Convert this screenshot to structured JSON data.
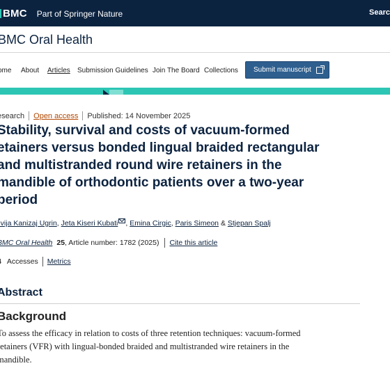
{
  "header": {
    "brand": "BMC",
    "part_of": "Part of Springer Nature",
    "search": "Searc"
  },
  "journal": {
    "title": "BMC Oral Health"
  },
  "nav": {
    "items": [
      {
        "label": "ome"
      },
      {
        "label": "About"
      },
      {
        "label": "Articles"
      },
      {
        "label": "Submission Guidelines"
      },
      {
        "label": "Join The Board"
      },
      {
        "label": "Collections"
      }
    ],
    "submit_label": "Submit manuscript"
  },
  "article": {
    "type": "esearch",
    "access": "Open access",
    "published": "Published: 14 November 2025",
    "title": "Stability, survival and costs of vacuum-formed retainers versus bonded lingual braided rectangular and multistranded round wire retainers in the mandible of orthodontic patients over a two-year period",
    "title_lines": [
      "Stability, survival and costs of vacuum-formed",
      "etainers versus bonded lingual braided rectangular",
      "and multistranded round wire retainers in the",
      "mandible of orthodontic patients over a two-year",
      "period"
    ],
    "authors": [
      {
        "name": "ilvija Kanizaj Ugrin"
      },
      {
        "name": "Jeta Kiseri Kubati"
      },
      {
        "name": "Emina Cirgic"
      },
      {
        "name": "Paris Simeon"
      },
      {
        "name": "Stjepan Spalj"
      }
    ],
    "author_sep": ",",
    "author_and": "&",
    "citation": {
      "journal": "BMC Oral Health",
      "volume": "25",
      "rest": ", Article number: 1782 (2025)",
      "cite_link": "Cite this article"
    },
    "metrics": {
      "count": "4",
      "accesses_label": "Accesses",
      "metrics_link": "Metrics"
    }
  },
  "abstract": {
    "heading": "Abstract",
    "background_heading": "Background",
    "background_lines": [
      "To assess the efficacy in relation to costs of three retention techniques: vacuum-formed",
      "retainers (VFR) with lingual-bonded braided and multistranded wire retainers in the",
      "mandible."
    ]
  },
  "colors": {
    "header_bg": "#0c2340",
    "teal": "#2dc6b4",
    "submit_bg": "#2e5f8f",
    "open_access": "#b34700"
  }
}
